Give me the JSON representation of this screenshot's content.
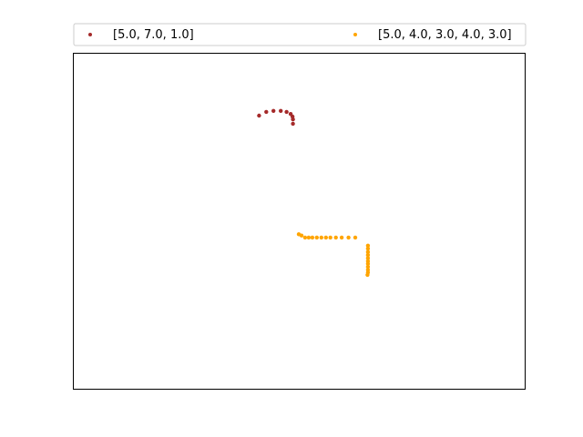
{
  "chart_data": {
    "type": "scatter",
    "title": "",
    "xlabel": "",
    "ylabel": "",
    "xlim": [
      0,
      100
    ],
    "ylim": [
      0,
      100
    ],
    "axes_ticks_visible": false,
    "grid": false,
    "legend_location": "above plot, two columns",
    "series": [
      {
        "name": "[5.0, 7.0, 1.0]",
        "color": "#a52a2a",
        "points": [
          [
            41.2,
            81.3
          ],
          [
            42.8,
            82.4
          ],
          [
            44.4,
            82.7
          ],
          [
            46.0,
            82.7
          ],
          [
            47.3,
            82.4
          ],
          [
            48.2,
            81.8
          ],
          [
            48.6,
            81.0
          ],
          [
            48.7,
            80.2
          ],
          [
            48.7,
            78.9
          ]
        ]
      },
      {
        "name": "[5.0, 4.0, 3.0, 4.0, 3.0]",
        "color": "#ffa500",
        "points": [
          [
            50.0,
            46.0
          ],
          [
            50.6,
            45.6
          ],
          [
            51.4,
            45.0
          ],
          [
            52.2,
            45.0
          ],
          [
            53.0,
            45.0
          ],
          [
            54.0,
            45.0
          ],
          [
            55.0,
            45.0
          ],
          [
            56.0,
            45.0
          ],
          [
            57.0,
            45.0
          ],
          [
            58.2,
            45.0
          ],
          [
            59.5,
            45.0
          ],
          [
            61.0,
            45.0
          ],
          [
            62.5,
            45.0
          ],
          [
            65.3,
            42.6
          ],
          [
            65.3,
            41.7
          ],
          [
            65.3,
            40.7
          ],
          [
            65.3,
            39.8
          ],
          [
            65.3,
            38.9
          ],
          [
            65.3,
            38.0
          ],
          [
            65.3,
            37.2
          ],
          [
            65.3,
            36.3
          ],
          [
            65.3,
            35.4
          ],
          [
            65.3,
            34.6
          ],
          [
            65.2,
            33.9
          ]
        ]
      }
    ]
  }
}
